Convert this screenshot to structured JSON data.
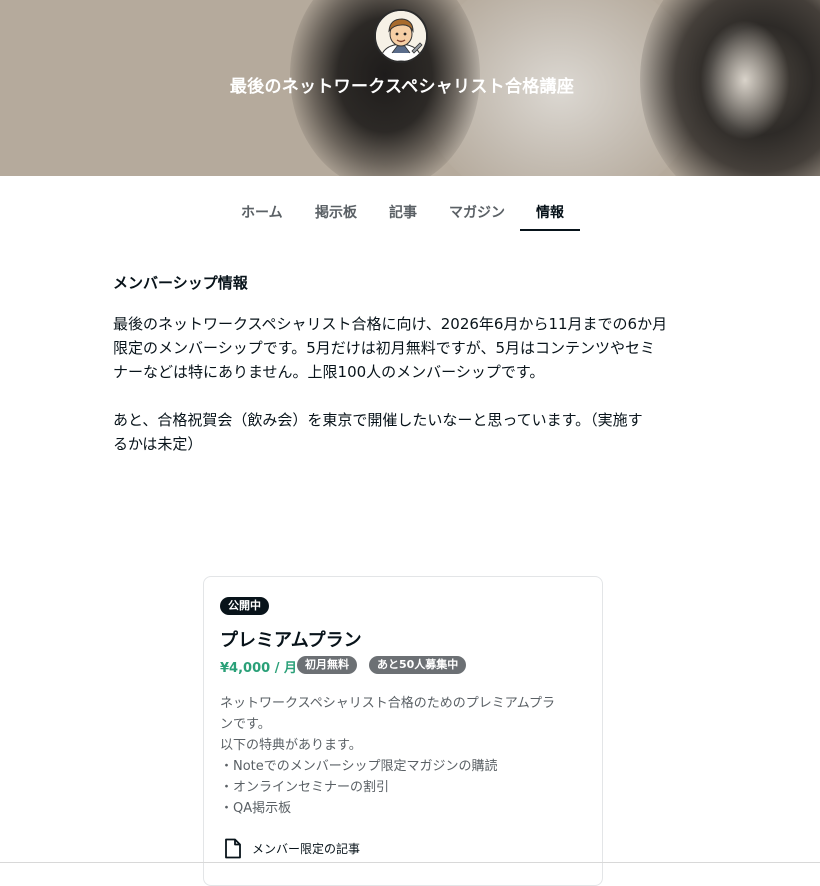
{
  "header": {
    "title": "最後のネットワークスペシャリスト合格講座",
    "avatar_icon": "person-avatar-icon"
  },
  "tabs": [
    {
      "label": "ホーム",
      "active": false
    },
    {
      "label": "掲示板",
      "active": false
    },
    {
      "label": "記事",
      "active": false
    },
    {
      "label": "マガジン",
      "active": false
    },
    {
      "label": "情報",
      "active": true
    }
  ],
  "info": {
    "heading": "メンバーシップ情報",
    "body": "最後のネットワークスペシャリスト合格に向け、2026年6月から11月までの6か月\n限定のメンバーシップです。5月だけは初月無料ですが、5月はコンテンツやセミ\nナーなどは特にありません。上限100人のメンバーシップです。\n\nあと、合格祝賀会（飲み会）を東京で開催したいなーと思っています。（実施す\nるかは未定）"
  },
  "plan": {
    "status_badge": "公開中",
    "name": "プレミアムプラン",
    "price": "¥4,000 / 月",
    "pills": [
      "初月無料",
      "あと50人募集中"
    ],
    "description": "ネットワークスペシャリスト合格のためのプレミアムプラ\nンです。\n以下の特典があります。\n・Noteでのメンバーシップ限定マガジンの購読\n・オンラインセミナーの割引\n・QA掲示板",
    "benefit_label": "メンバー限定の記事",
    "benefit_icon": "document-icon",
    "colors": {
      "price": "#2aa078",
      "badge": "#08131a",
      "pill": "#6c7074"
    }
  }
}
